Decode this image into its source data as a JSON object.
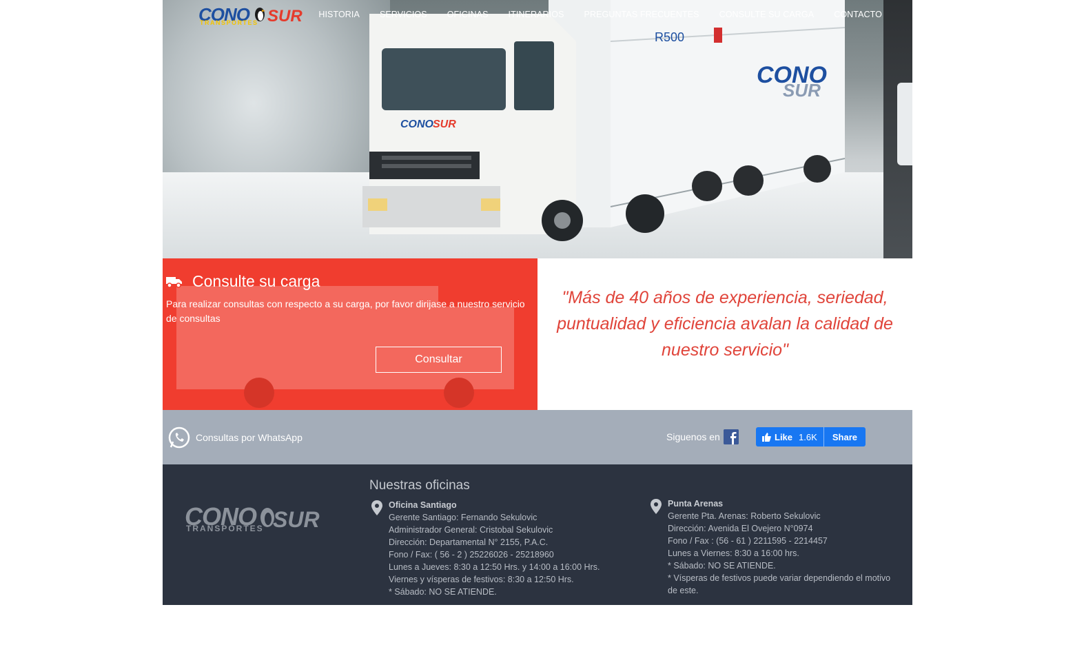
{
  "header": {
    "logo": {
      "brand_part1": "CONO",
      "brand_part2": "SUR",
      "tagline": "TRANSPORTES"
    },
    "nav": [
      "HISTORIA",
      "SERVICIOS",
      "OFICINAS",
      "ITINERARIOS",
      "PREGUNTAS FRECUENTES",
      "CONSULTE SU CARGA",
      "CONTACTO"
    ]
  },
  "hero": {
    "image": "truck-in-snow",
    "truck_brand": "CONO SUR",
    "truck_code": "R500"
  },
  "consult": {
    "icon": "truck-icon",
    "title": "Consulte su carga",
    "description": "Para realizar consultas con respecto a su carga, por favor dirijase a nuestro servicio de consultas",
    "button": "Consultar"
  },
  "quote": {
    "text": "\"Más de 40 años de experiencia, seriedad, puntualidad y eficiencia avalan la calidad de nuestro servicio\""
  },
  "social": {
    "whatsapp": "Consultas por WhatsApp",
    "follow": "Siguenos en",
    "fb_like": "Like",
    "fb_count": "1.6K",
    "fb_share": "Share"
  },
  "footer": {
    "logo": {
      "brand_part1": "CONO",
      "brand_part2": "SUR",
      "tagline": "TRANSPORTES"
    },
    "offices_title": "Nuestras oficinas",
    "offices": [
      {
        "name": "Oficina Santiago",
        "lines": [
          "Gerente Santiago: Fernando Sekulovic",
          "Administrador General: Cristobal Sekulovic",
          "Dirección: Departamental N° 2155, P.A.C.",
          "Fono / Fax: ( 56 - 2 ) 25226026 - 25218960",
          "Lunes a Jueves: 8:30 a 12:50 Hrs. y 14:00 a 16:00 Hrs.",
          "Viernes y vísperas de festivos: 8:30 a 12:50 Hrs.",
          "* Sábado: NO SE ATIENDE."
        ]
      },
      {
        "name": "Punta Arenas",
        "lines": [
          "Gerente Pta. Arenas: Roberto Sekulovic",
          "Dirección: Avenida El Ovejero N°0974",
          "Fono / Fax : (56 - 61 ) 2211595 - 2214457",
          "Lunes a Viernes: 8:30 a 16:00 hrs.",
          "* Sábado: NO SE ATIENDE.",
          "* Vísperas de festivos puede variar dependiendo el motivo de este."
        ]
      }
    ]
  },
  "colors": {
    "accent_red": "#f03d2f",
    "quote_red": "#e0443a",
    "social_bar": "#a4adb9",
    "footer_bg": "#2c3340",
    "facebook": "#1877f2"
  }
}
